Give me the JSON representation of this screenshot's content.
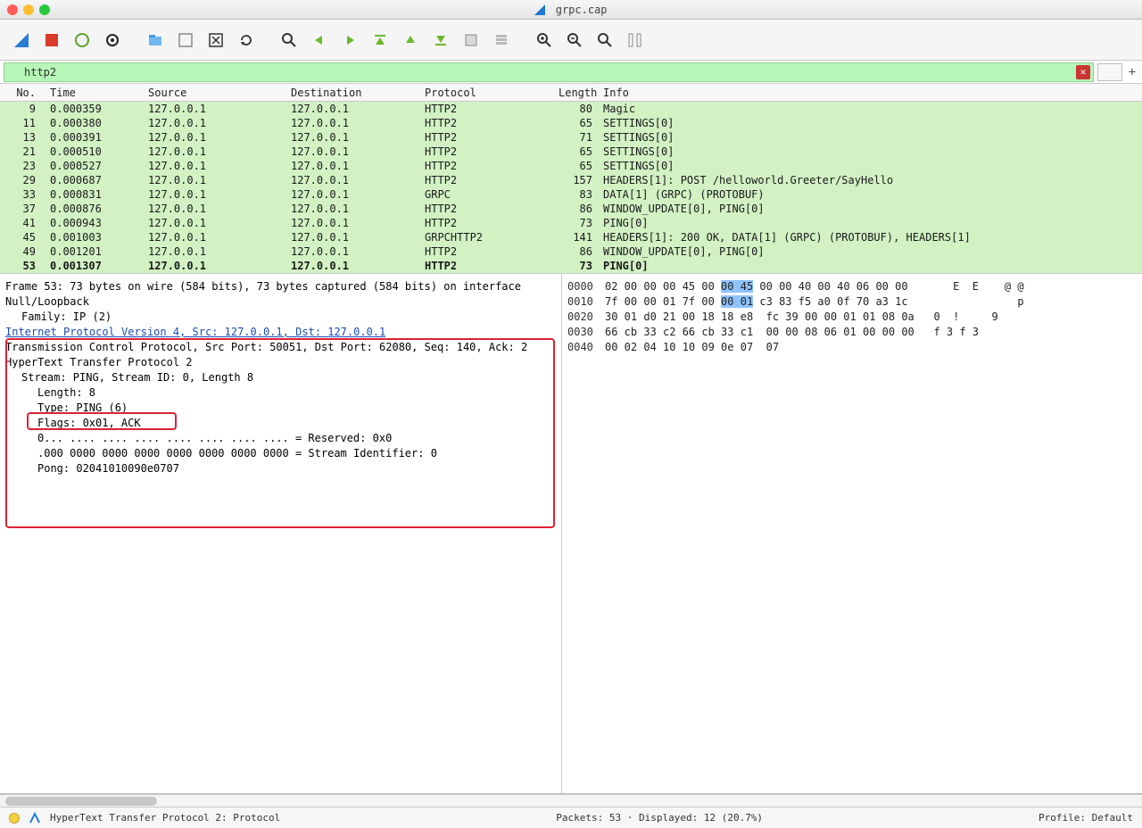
{
  "window": {
    "title": "grpc.cap"
  },
  "filter": {
    "value": "http2"
  },
  "columns": {
    "no": "No.",
    "time": "Time",
    "source": "Source",
    "destination": "Destination",
    "protocol": "Protocol",
    "length": "Length",
    "info": "Info"
  },
  "packets": [
    {
      "no": "9",
      "time": "0.000359",
      "src": "127.0.0.1",
      "dst": "127.0.0.1",
      "proto": "HTTP2",
      "len": "80",
      "info": "Magic"
    },
    {
      "no": "11",
      "time": "0.000380",
      "src": "127.0.0.1",
      "dst": "127.0.0.1",
      "proto": "HTTP2",
      "len": "65",
      "info": "SETTINGS[0]"
    },
    {
      "no": "13",
      "time": "0.000391",
      "src": "127.0.0.1",
      "dst": "127.0.0.1",
      "proto": "HTTP2",
      "len": "71",
      "info": "SETTINGS[0]"
    },
    {
      "no": "21",
      "time": "0.000510",
      "src": "127.0.0.1",
      "dst": "127.0.0.1",
      "proto": "HTTP2",
      "len": "65",
      "info": "SETTINGS[0]"
    },
    {
      "no": "23",
      "time": "0.000527",
      "src": "127.0.0.1",
      "dst": "127.0.0.1",
      "proto": "HTTP2",
      "len": "65",
      "info": "SETTINGS[0]"
    },
    {
      "no": "29",
      "time": "0.000687",
      "src": "127.0.0.1",
      "dst": "127.0.0.1",
      "proto": "HTTP2",
      "len": "157",
      "info": "HEADERS[1]: POST /helloworld.Greeter/SayHello"
    },
    {
      "no": "33",
      "time": "0.000831",
      "src": "127.0.0.1",
      "dst": "127.0.0.1",
      "proto": "GRPC",
      "len": "83",
      "info": "DATA[1] (GRPC) (PROTOBUF)"
    },
    {
      "no": "37",
      "time": "0.000876",
      "src": "127.0.0.1",
      "dst": "127.0.0.1",
      "proto": "HTTP2",
      "len": "86",
      "info": "WINDOW_UPDATE[0], PING[0]"
    },
    {
      "no": "41",
      "time": "0.000943",
      "src": "127.0.0.1",
      "dst": "127.0.0.1",
      "proto": "HTTP2",
      "len": "73",
      "info": "PING[0]"
    },
    {
      "no": "45",
      "time": "0.001003",
      "src": "127.0.0.1",
      "dst": "127.0.0.1",
      "proto": "GRPCHTTP2",
      "len": "141",
      "info": "HEADERS[1]: 200 OK, DATA[1] (GRPC) (PROTOBUF), HEADERS[1]"
    },
    {
      "no": "49",
      "time": "0.001201",
      "src": "127.0.0.1",
      "dst": "127.0.0.1",
      "proto": "HTTP2",
      "len": "86",
      "info": "WINDOW_UPDATE[0], PING[0]"
    },
    {
      "no": "53",
      "time": "0.001307",
      "src": "127.0.0.1",
      "dst": "127.0.0.1",
      "proto": "HTTP2",
      "len": "73",
      "info": "PING[0]",
      "selected": true
    }
  ],
  "details": {
    "l0a": "Frame 53: 73 bytes on wire (584 bits), 73 bytes captured (584 bits) on interface",
    "l0b": "Null/Loopback",
    "l0c": "Family: IP (2)",
    "link": "Internet Protocol Version 4, Src: 127.0.0.1, Dst: 127.0.0.1",
    "lTcp": "Transmission Control Protocol, Src Port: 50051, Dst Port: 62080, Seq: 140, Ack: 2",
    "lHttp2": "HyperText Transfer Protocol 2",
    "lStream": "Stream: PING, Stream ID: 0, Length 8",
    "lLen": "Length: 8",
    "lType": "Type: PING (6)",
    "lFlags": "Flags: 0x01, ACK",
    "lRes": "0... .... .... .... .... .... .... .... = Reserved: 0x0",
    "lSid": ".000 0000 0000 0000 0000 0000 0000 0000 = Stream Identifier: 0",
    "lPong": "Pong: 02041010090e0707"
  },
  "hex": {
    "r0": {
      "off": "0000",
      "b": "02 00 00 00 45 00 ",
      "hl": "00 45",
      "b2": " 00 00 40 00 40 06 00 00",
      "a": "    E  E    @ @"
    },
    "r1": {
      "off": "0010",
      "b": "7f 00 00 01 7f 00 ",
      "hl": "00 01",
      "b2": " c3 83 f5 a0 0f 70 a3 1c",
      "a": "              p"
    },
    "r2": {
      "off": "0020",
      "b": "30 01 d0 21 00 18 18 e8  fc 39 00 00 01 01 08 0a",
      "a": "0  !     9"
    },
    "r3": {
      "off": "0030",
      "b": "66 cb 33 c2 66 cb 33 c1  00 00 08 06 01 00 00 00",
      "a": "f 3 f 3"
    },
    "r4": {
      "off": "0040",
      "b": "00 02 04 10 10 09 0e 07  07",
      "a": ""
    }
  },
  "status": {
    "left": "HyperText Transfer Protocol 2: Protocol",
    "mid": "Packets: 53 · Displayed: 12 (20.7%)",
    "right": "Profile: Default"
  }
}
